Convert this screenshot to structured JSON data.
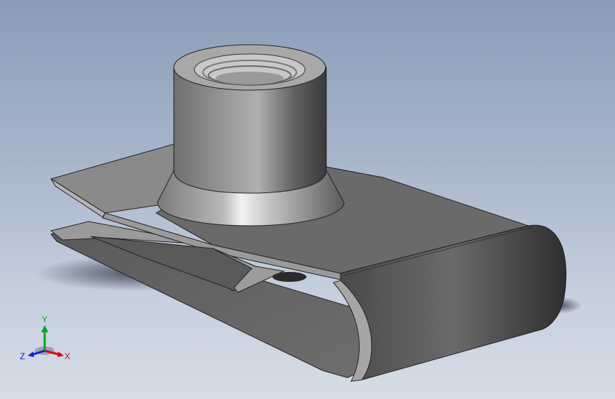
{
  "viewport": {
    "background_top": "#8a9cb8",
    "background_bottom": "#d6dde8"
  },
  "model": {
    "part": "u-clip-nut",
    "body_color": "#7a7a7a"
  },
  "triad": {
    "x_label": "X",
    "y_label": "Y",
    "z_label": "Z",
    "x_color": "#d01010",
    "y_color": "#10a020",
    "z_color": "#1020d0"
  }
}
